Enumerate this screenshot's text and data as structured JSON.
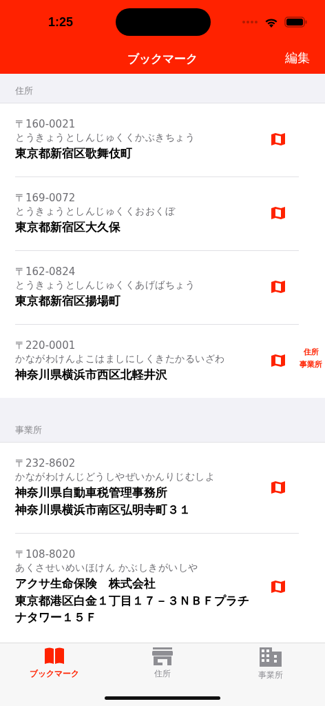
{
  "status_bar": {
    "time": "1:25"
  },
  "nav": {
    "title": "ブックマーク",
    "edit": "編集"
  },
  "sections": [
    {
      "title": "住所",
      "items": [
        {
          "postal": "〒160-0021",
          "reading": "とうきょうとしんじゅくくかぶきちょう",
          "lines": [
            "東京都新宿区歌舞伎町"
          ]
        },
        {
          "postal": "〒169-0072",
          "reading": "とうきょうとしんじゅくくおおくぼ",
          "lines": [
            "東京都新宿区大久保"
          ]
        },
        {
          "postal": "〒162-0824",
          "reading": "とうきょうとしんじゅくくあげばちょう",
          "lines": [
            "東京都新宿区揚場町"
          ]
        },
        {
          "postal": "〒220-0001",
          "reading": "かながわけんよこはましにしくきたかるいざわ",
          "lines": [
            "神奈川県横浜市西区北軽井沢"
          ]
        }
      ]
    },
    {
      "title": "事業所",
      "items": [
        {
          "postal": "〒232-8602",
          "reading": "かながわけんじどうしやぜいかんりじむしよ",
          "lines": [
            "神奈川県自動車税管理事務所",
            "神奈川県横浜市南区弘明寺町３１"
          ]
        },
        {
          "postal": "〒108-8020",
          "reading": "あくさせいめいほけん かぶしきがいしや",
          "lines": [
            "アクサ生命保険　株式会社",
            "東京都港区白金１丁目１７－３ＮＢＦプラチナタワー１５Ｆ"
          ]
        }
      ]
    }
  ],
  "section_index": [
    "住所",
    "事業所"
  ],
  "tabs": [
    {
      "label": "ブックマーク",
      "kind": "book",
      "selected": true
    },
    {
      "label": "住所",
      "kind": "store",
      "selected": false
    },
    {
      "label": "事業所",
      "kind": "building",
      "selected": false
    }
  ]
}
